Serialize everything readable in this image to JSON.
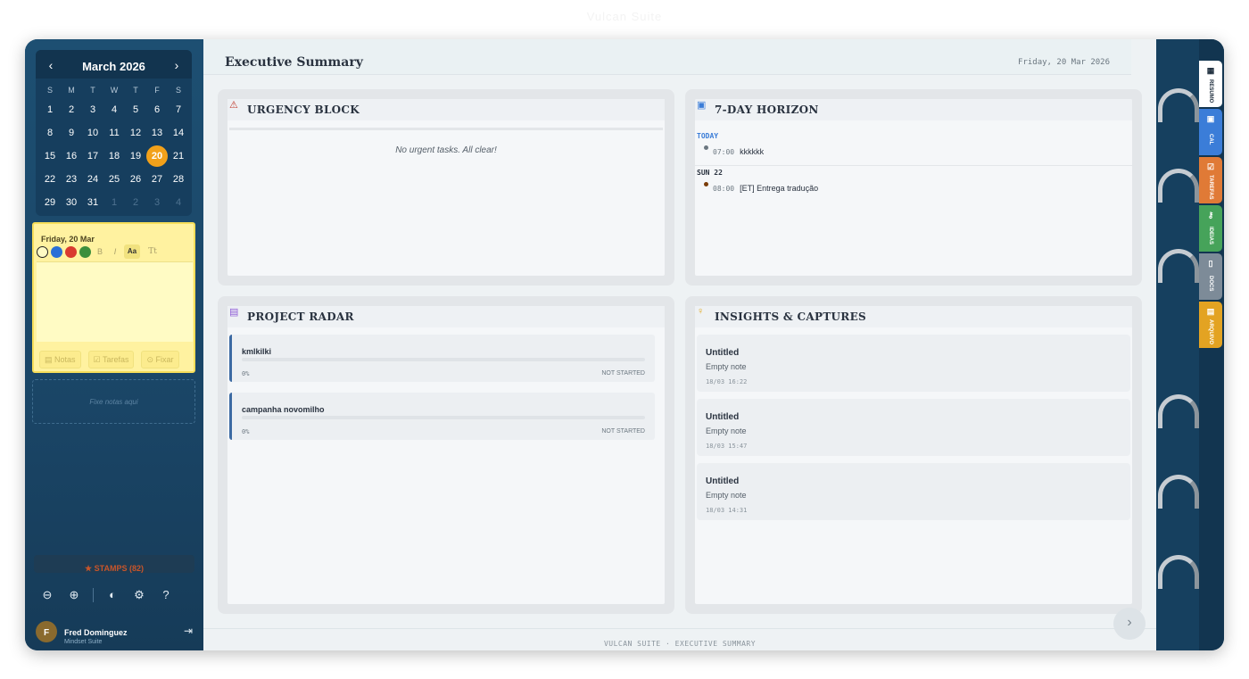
{
  "window": {
    "title": "Vulcan Suite"
  },
  "calendar": {
    "month_label": "March 2026",
    "prev_icon": "chevron-left-icon",
    "next_icon": "chevron-right-icon",
    "weekdays": [
      "S",
      "M",
      "T",
      "W",
      "T",
      "F",
      "S"
    ],
    "days": [
      "1",
      "2",
      "3",
      "4",
      "5",
      "6",
      "7",
      "8",
      "9",
      "10",
      "11",
      "12",
      "13",
      "14",
      "15",
      "16",
      "17",
      "18",
      "19",
      "20",
      "21",
      "22",
      "23",
      "24",
      "25",
      "26",
      "27",
      "28",
      "29",
      "30",
      "31"
    ],
    "trailing_days": [
      "1",
      "2",
      "3",
      "4"
    ],
    "selected_day": "20",
    "selected_color": "#f2a11a"
  },
  "note": {
    "date": "Friday, 20 Mar",
    "colors": [
      "#fffbc4",
      "#2a6fd6",
      "#d93a2f",
      "#3c8f3d"
    ],
    "bold_label": "B",
    "italic_label": "I",
    "size_label": "Aa",
    "font_label": "Tt",
    "actions": [
      "Notas",
      "Tarefas",
      "Fixar"
    ]
  },
  "pin_area": {
    "placeholder": "Fixe notas aqui"
  },
  "stamps": {
    "label": "STAMPS (82)"
  },
  "toolbar_icons": [
    "zoom-out-icon",
    "zoom-in-icon",
    "palette-icon",
    "gear-icon",
    "help-icon"
  ],
  "user": {
    "initial": "F",
    "name": "Fred Dominguez",
    "subtitle": "Mindset Suite"
  },
  "header": {
    "title": "Executive Summary",
    "date": "Friday, 20 Mar 2026"
  },
  "urgency": {
    "title": "URGENCY BLOCK",
    "empty": "No urgent tasks. All clear!",
    "icon_color": "#c0392b"
  },
  "horizon": {
    "title": "7-DAY HORIZON",
    "icon_color": "#3b7dd8",
    "groups": [
      {
        "label": "TODAY",
        "label_color": "#3b7dd8",
        "events": [
          {
            "time": "07:00",
            "text": "kkkkkk",
            "dot": "#6b7780"
          }
        ]
      },
      {
        "label": "SUN 22",
        "label_color": "#2a3340",
        "events": [
          {
            "time": "08:00",
            "text": "[ET] Entrega tradução",
            "dot": "#7a3d0a"
          }
        ]
      }
    ]
  },
  "projects": {
    "title": "PROJECT RADAR",
    "icon_color": "#8e5bd6",
    "items": [
      {
        "name": "kmlkilki",
        "pct": "0%",
        "status": "NOT STARTED"
      },
      {
        "name": "campanha novomilho",
        "pct": "0%",
        "status": "NOT STARTED"
      }
    ]
  },
  "insights": {
    "title": "INSIGHTS & CAPTURES",
    "icon_color": "#e0a81d",
    "items": [
      {
        "title": "Untitled",
        "body": "Empty note",
        "date": "18/03 16:22"
      },
      {
        "title": "Untitled",
        "body": "Empty note",
        "date": "18/03 15:47"
      },
      {
        "title": "Untitled",
        "body": "Empty note",
        "date": "18/03 14:31"
      }
    ]
  },
  "footer": {
    "text": "VULCAN SUITE · EXECUTIVE SUMMARY"
  },
  "tabs": [
    {
      "label": "RESUMO",
      "icon": "grid-icon",
      "color": "#ffffff",
      "text": "#1a2a3a"
    },
    {
      "label": "CAL",
      "icon": "calendar-icon",
      "color": "#3b7dd8",
      "text": "#ffffff"
    },
    {
      "label": "TAREFAS",
      "icon": "check-icon",
      "color": "#e07a36",
      "text": "#ffffff"
    },
    {
      "label": "IDEIAS",
      "icon": "key-icon",
      "color": "#46a35a",
      "text": "#ffffff"
    },
    {
      "label": "DOCS",
      "icon": "file-icon",
      "color": "#7d8b98",
      "text": "#ffffff"
    },
    {
      "label": "ARQUIVO",
      "icon": "box-icon",
      "color": "#e3a322",
      "text": "#ffffff"
    }
  ]
}
